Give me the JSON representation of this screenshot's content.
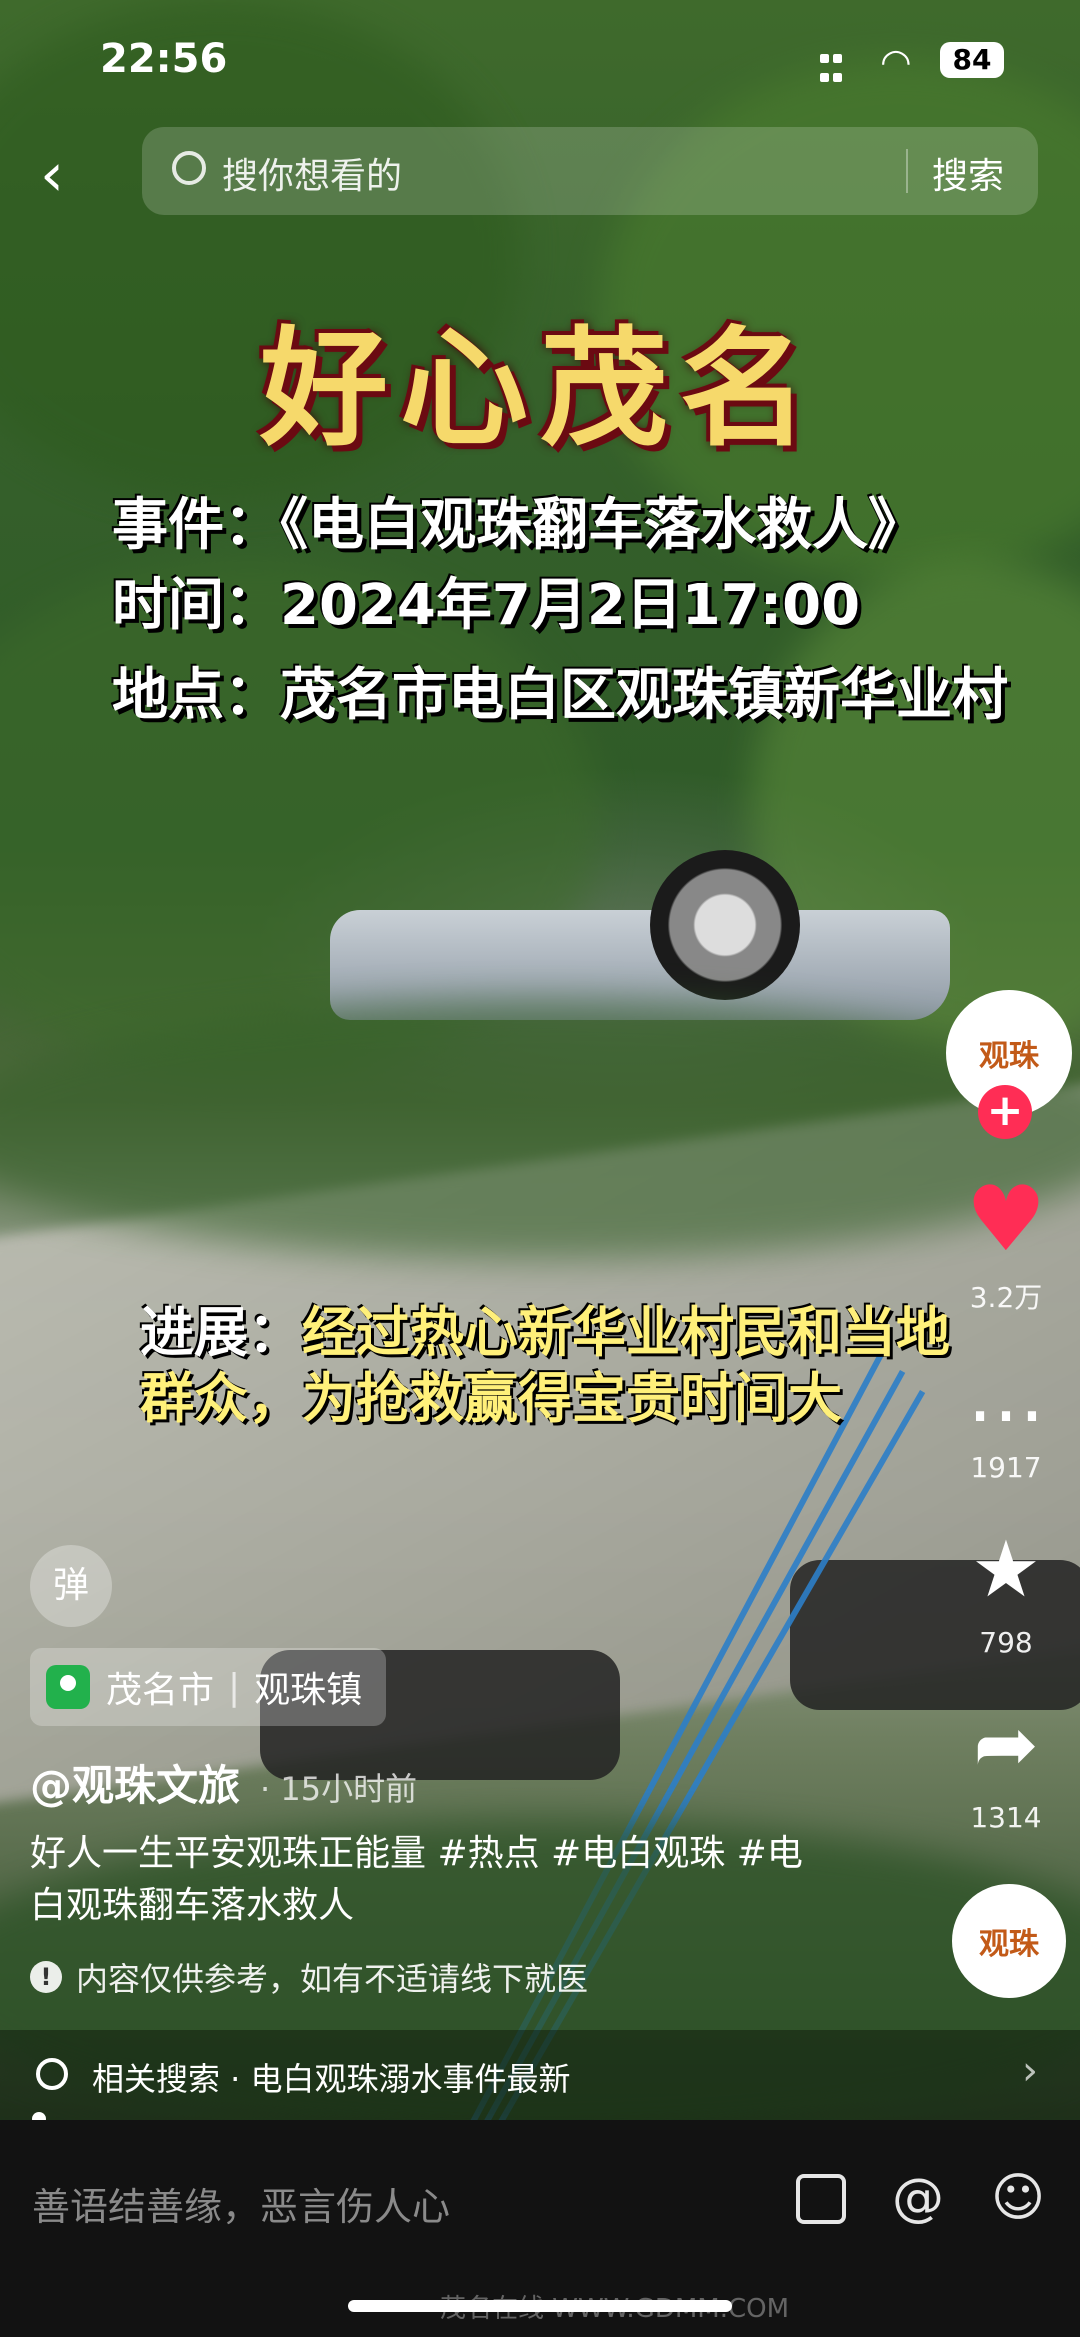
{
  "status_bar": {
    "time": "22:56",
    "battery": "84"
  },
  "search": {
    "placeholder": "搜你想看的",
    "button": "搜索"
  },
  "video_overlay": {
    "title": "好心茂名",
    "event": "事件：《电白观珠翻车落水救人》",
    "time": "时间：2024年7月2日17:00",
    "place": "地点：茂名市电白区观珠镇新华业村",
    "progress_label": "进展：",
    "progress_text": "经过热心新华业村民和当地群众，为抢救赢得宝贵时间大"
  },
  "actions": {
    "author_avatar_text": "观珠",
    "likes": "3.2万",
    "comments": "1917",
    "favorites": "798",
    "shares": "1314",
    "music_avatar_text": "观珠"
  },
  "danmu_label": "弹",
  "location": {
    "city": "茂名市",
    "town": "观珠镇"
  },
  "post": {
    "author": "@观珠文旅",
    "time_ago": "· 15小时前",
    "description": "好人一生平安观珠正能量 #热点 #电白观珠 #电白观珠翻车落水救人",
    "notice": "内容仅供参考，如有不适请线下就医"
  },
  "related_search": {
    "label": "相关搜索 · 电白观珠溺水事件最新"
  },
  "comment_bar": {
    "placeholder": "善语结善缘，恶言伤人心"
  },
  "watermark": "茂名在线 WWW.GDMM.COM",
  "icons": [
    "back-icon",
    "search-icon",
    "heart-icon",
    "comment-icon",
    "star-icon",
    "share-icon",
    "image-icon",
    "at-icon",
    "emoji-icon",
    "location-pin-icon",
    "info-icon",
    "chevron-right-icon"
  ],
  "colors": {
    "like": "#ff2d55",
    "follow": "#ff2d55",
    "location_pin": "#22b14c",
    "title_gold": "#f6d96b",
    "progress_yellow": "#fff07a"
  }
}
